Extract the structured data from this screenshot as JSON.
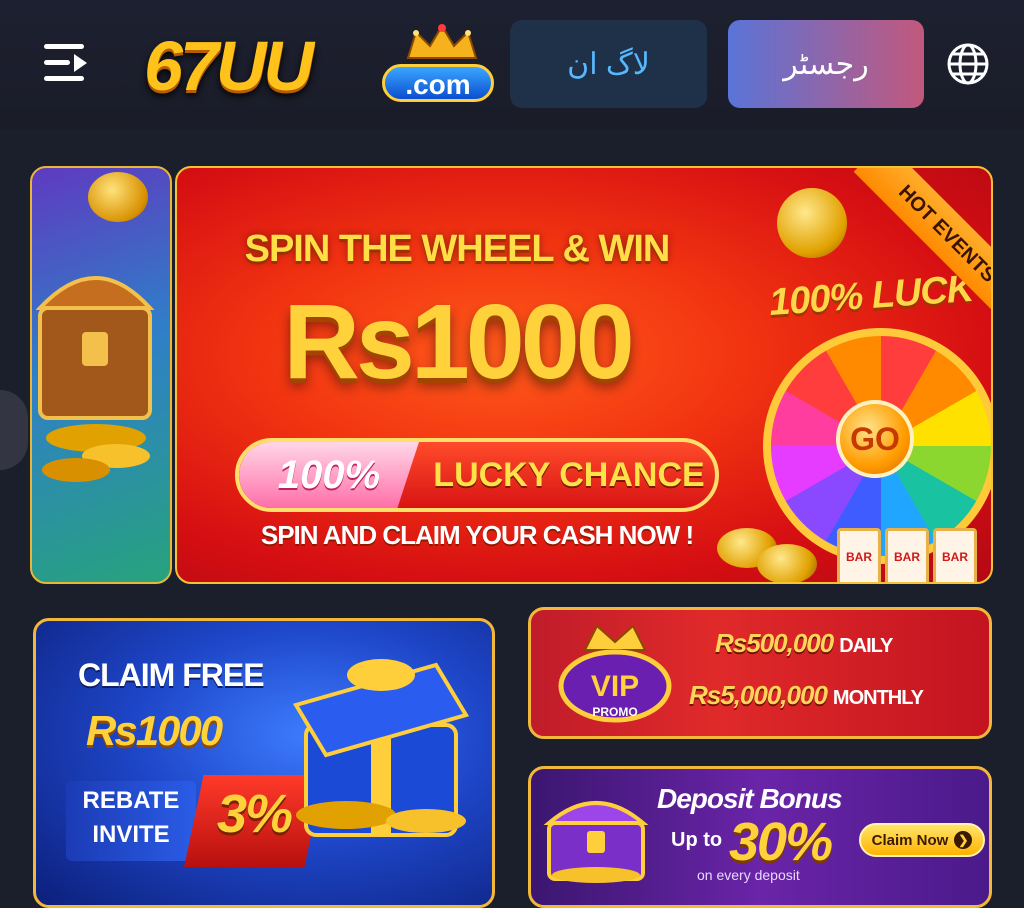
{
  "header": {
    "menu_icon": "menu-icon",
    "logo": {
      "main": "67UU",
      "suffix": ".com"
    },
    "login_label": "لاگ ان",
    "register_label": "رجسٹر",
    "language_icon": "globe-icon"
  },
  "banner": {
    "title": "SPIN THE WHEEL & WIN",
    "amount": "Rs1000",
    "lucky_percent": "100%",
    "lucky_label": "LUCKY CHANCE",
    "subtitle": "SPIN AND CLAIM YOUR CASH NOW !",
    "luck_text": "100% LUCK",
    "go_label": "GO",
    "ribbon": "HOT EVENTS",
    "slot_text": "BAR"
  },
  "promos": {
    "claim": {
      "title": "CLAIM FREE",
      "amount": "Rs1000",
      "rebate": "REBATE",
      "invite": "INVITE",
      "percent": "3%"
    },
    "vip": {
      "badge_top": "VIP",
      "badge_bottom": "PROMO",
      "daily_amount": "Rs500,000",
      "daily_label": "DAILY",
      "monthly_amount": "Rs5,000,000",
      "monthly_label": "MONTHLY"
    },
    "deposit": {
      "title": "Deposit Bonus",
      "upto": "Up to",
      "percent": "30%",
      "note": "on every deposit",
      "claim_label": "Claim Now"
    }
  },
  "colors": {
    "background": "#1b1e2b",
    "login_bg": "#1e3148",
    "login_text": "#58b8ff",
    "register_gradient_start": "#5a74d8",
    "register_gradient_end": "#c2587c",
    "gold": "#ffd23b"
  }
}
